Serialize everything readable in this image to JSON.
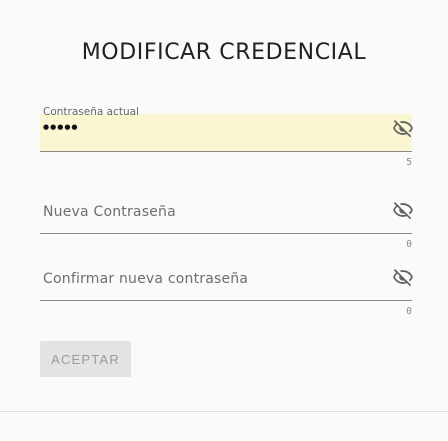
{
  "title": "MODIFICAR CREDENCIAL",
  "fields": [
    {
      "label": "Contraseña actual",
      "value": "●●●●●",
      "counter": "5",
      "icon": "eye-off-icon"
    },
    {
      "label": "Nueva Contraseña",
      "value": "",
      "counter": "0",
      "icon": "eye-off-icon"
    },
    {
      "label": "Confirmar nueva contraseña",
      "value": "",
      "counter": "0",
      "icon": "eye-off-icon"
    }
  ],
  "submit_label": "ACEPTAR",
  "colors": {
    "autofill_bg": "#faf6d2",
    "button_bg": "#e3e3e3"
  }
}
